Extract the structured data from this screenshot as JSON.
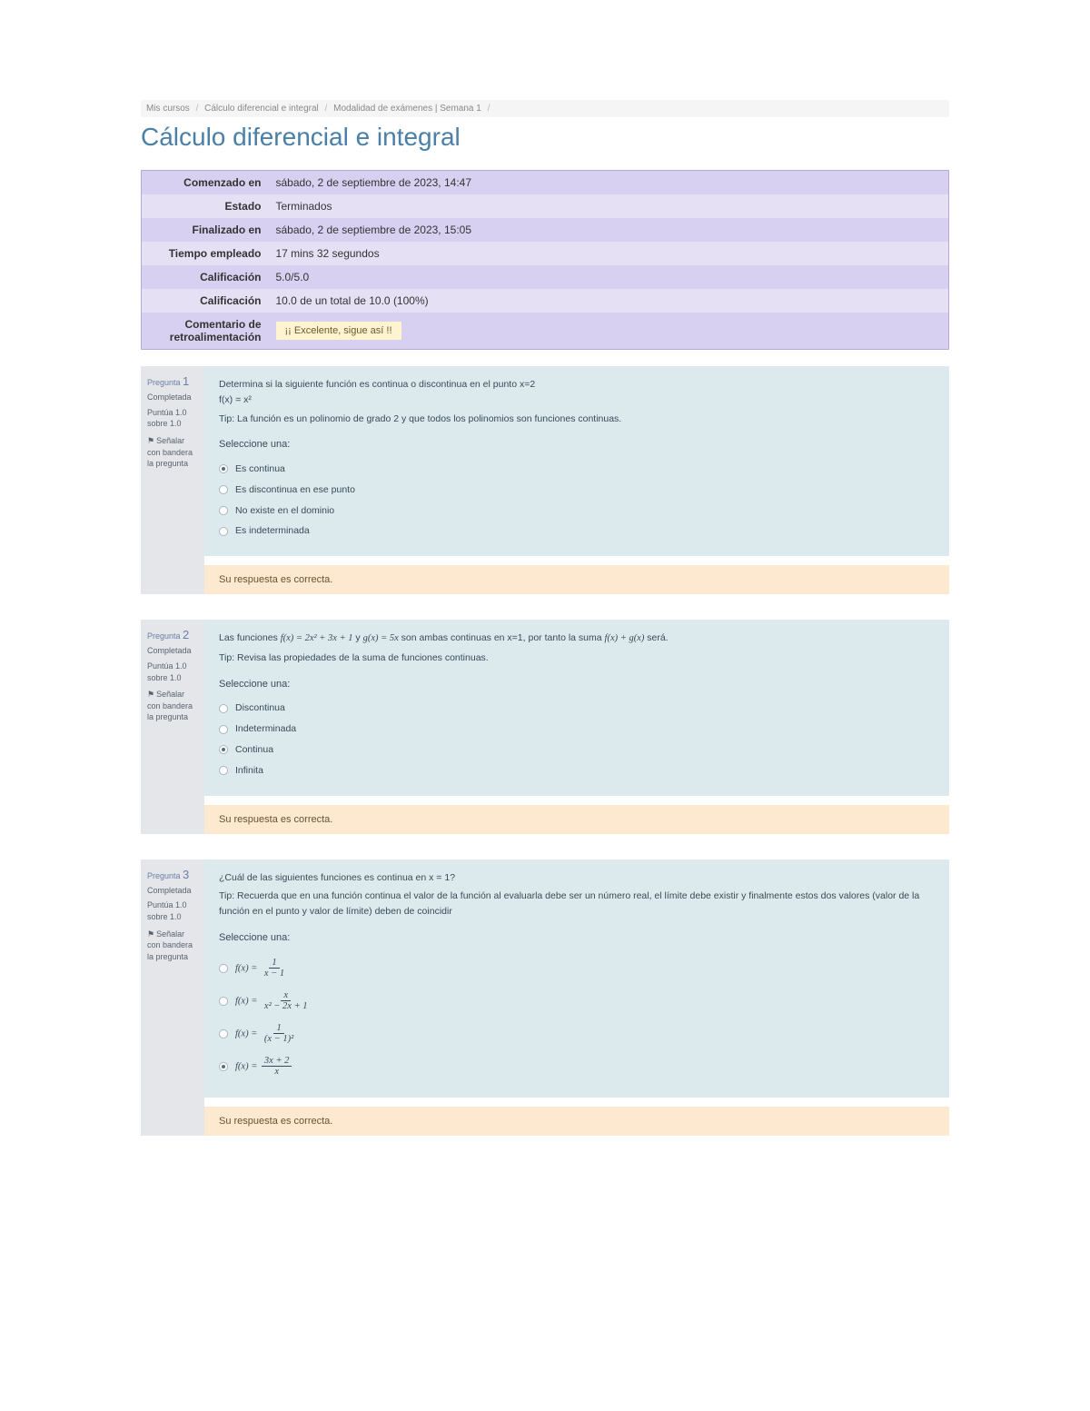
{
  "breadcrumb": {
    "items": [
      "Mis cursos",
      "Cálculo diferencial e integral",
      "Modalidad de exámenes | Semana 1"
    ]
  },
  "title": "Cálculo diferencial e integral",
  "summary": {
    "rows": [
      {
        "label": "Comenzado en",
        "value": "sábado, 2 de septiembre de 2023, 14:47"
      },
      {
        "label": "Estado",
        "value": "Terminados"
      },
      {
        "label": "Finalizado en",
        "value": "sábado, 2 de septiembre de 2023, 15:05"
      },
      {
        "label": "Tiempo empleado",
        "value": "17 mins 32 segundos"
      },
      {
        "label": "Calificación",
        "value": "5.0/5.0"
      },
      {
        "label": "Calificación",
        "value": "10.0 de un total de 10.0 (100%)"
      },
      {
        "label": "Comentario de retroalimentación",
        "value": "¡¡ Excelente, sigue así !!"
      }
    ]
  },
  "questions": [
    {
      "num_prefix": "Pregunta",
      "num": "1",
      "state": "Completada",
      "grade": "Puntúa 1.0 sobre 1.0",
      "flag_label": "Señalar con bandera la pregunta",
      "text": "Determina si la siguiente función es continua o discontinua en el punto x=2",
      "formula": "f(x) = x²",
      "tip": "Tip: La función es un polinomio de grado 2 y que todos los polinomios son funciones continuas.",
      "select_label": "Seleccione una:",
      "options": [
        {
          "label": "Es continua",
          "checked": true
        },
        {
          "label": "Es discontinua en ese punto",
          "checked": false
        },
        {
          "label": "No existe en el dominio",
          "checked": false
        },
        {
          "label": "Es indeterminada",
          "checked": false
        }
      ],
      "feedback": "Su respuesta es correcta."
    },
    {
      "num_prefix": "Pregunta",
      "num": "2",
      "state": "Completada",
      "grade": "Puntúa 1.0 sobre 1.0",
      "flag_label": "Señalar con bandera la pregunta",
      "text_pre": "Las funciones ",
      "text_f": "f(x) = 2x² + 3x + 1",
      "text_mid": " y ",
      "text_g": "g(x) = 5x",
      "text_post": " son ambas continuas en x=1, por tanto la suma ",
      "text_sum": "f(x) + g(x)",
      "text_end": " será.",
      "tip": "Tip: Revisa las propiedades de la suma de funciones continuas.",
      "select_label": "Seleccione una:",
      "options": [
        {
          "label": "Discontinua",
          "checked": false
        },
        {
          "label": "Indeterminada",
          "checked": false
        },
        {
          "label": "Continua",
          "checked": true
        },
        {
          "label": "Infinita",
          "checked": false
        }
      ],
      "feedback": "Su respuesta es correcta."
    },
    {
      "num_prefix": "Pregunta",
      "num": "3",
      "state": "Completada",
      "grade": "Puntúa 1.0 sobre 1.0",
      "flag_label": "Señalar con bandera la pregunta",
      "text": "¿Cuál de las siguientes funciones es continua en x = 1?",
      "tip": "Tip: Recuerda que en una función continua el valor de la función al evaluarla debe ser un número real, el límite debe existir y finalmente estos dos valores (valor de la función en el punto y valor de límite) deben de coincidir",
      "select_label": "Seleccione una:",
      "options": [
        {
          "prefix": "f(x) = ",
          "num": "1",
          "den": "x − 1",
          "checked": false
        },
        {
          "prefix": "f(x) = ",
          "num": "x",
          "den": "x² − 2x + 1",
          "checked": false
        },
        {
          "prefix": "f(x) = ",
          "num": "1",
          "den": "(x − 1)²",
          "checked": false
        },
        {
          "prefix": "f(x) = ",
          "num": "3x + 2",
          "den": "x",
          "checked": true
        }
      ],
      "feedback": "Su respuesta es correcta."
    }
  ]
}
